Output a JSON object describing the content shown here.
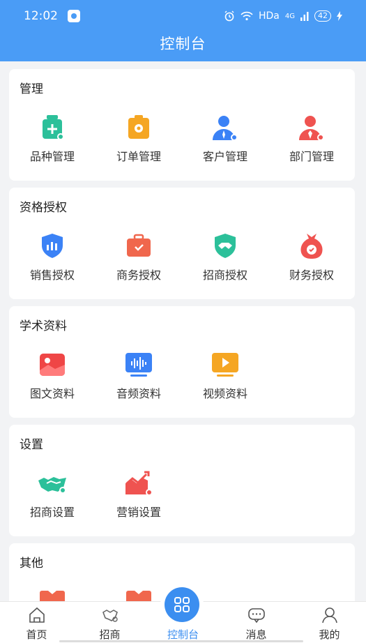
{
  "status_bar": {
    "time": "12:02",
    "indicators": "HDa",
    "network": "4G",
    "battery": "42"
  },
  "header": {
    "title": "控制台"
  },
  "sections": [
    {
      "title": "管理",
      "items": [
        {
          "label": "品种管理",
          "icon": "product-icon"
        },
        {
          "label": "订单管理",
          "icon": "order-icon"
        },
        {
          "label": "客户管理",
          "icon": "customer-icon"
        },
        {
          "label": "部门管理",
          "icon": "department-icon"
        }
      ]
    },
    {
      "title": "资格授权",
      "items": [
        {
          "label": "销售授权",
          "icon": "sales-auth-icon"
        },
        {
          "label": "商务授权",
          "icon": "business-auth-icon"
        },
        {
          "label": "招商授权",
          "icon": "investment-auth-icon"
        },
        {
          "label": "财务授权",
          "icon": "finance-auth-icon"
        }
      ]
    },
    {
      "title": "学术资料",
      "items": [
        {
          "label": "图文资料",
          "icon": "image-doc-icon"
        },
        {
          "label": "音频资料",
          "icon": "audio-doc-icon"
        },
        {
          "label": "视频资料",
          "icon": "video-doc-icon"
        }
      ]
    },
    {
      "title": "设置",
      "items": [
        {
          "label": "招商设置",
          "icon": "investment-settings-icon"
        },
        {
          "label": "营销设置",
          "icon": "marketing-settings-icon"
        }
      ]
    },
    {
      "title": "其他",
      "items": []
    }
  ],
  "tabbar": {
    "tabs": [
      {
        "label": "首页",
        "icon": "home-icon"
      },
      {
        "label": "招商",
        "icon": "handshake-icon"
      },
      {
        "label": "控制台",
        "icon": "grid-icon",
        "active": true
      },
      {
        "label": "消息",
        "icon": "message-icon"
      },
      {
        "label": "我的",
        "icon": "profile-icon"
      }
    ]
  },
  "colors": {
    "primary": "#4a9cf6",
    "active_tab": "#3b8ef0",
    "green": "#2cc09a",
    "orange": "#f5a623",
    "blue": "#3b82f6",
    "red": "#ef5350"
  }
}
